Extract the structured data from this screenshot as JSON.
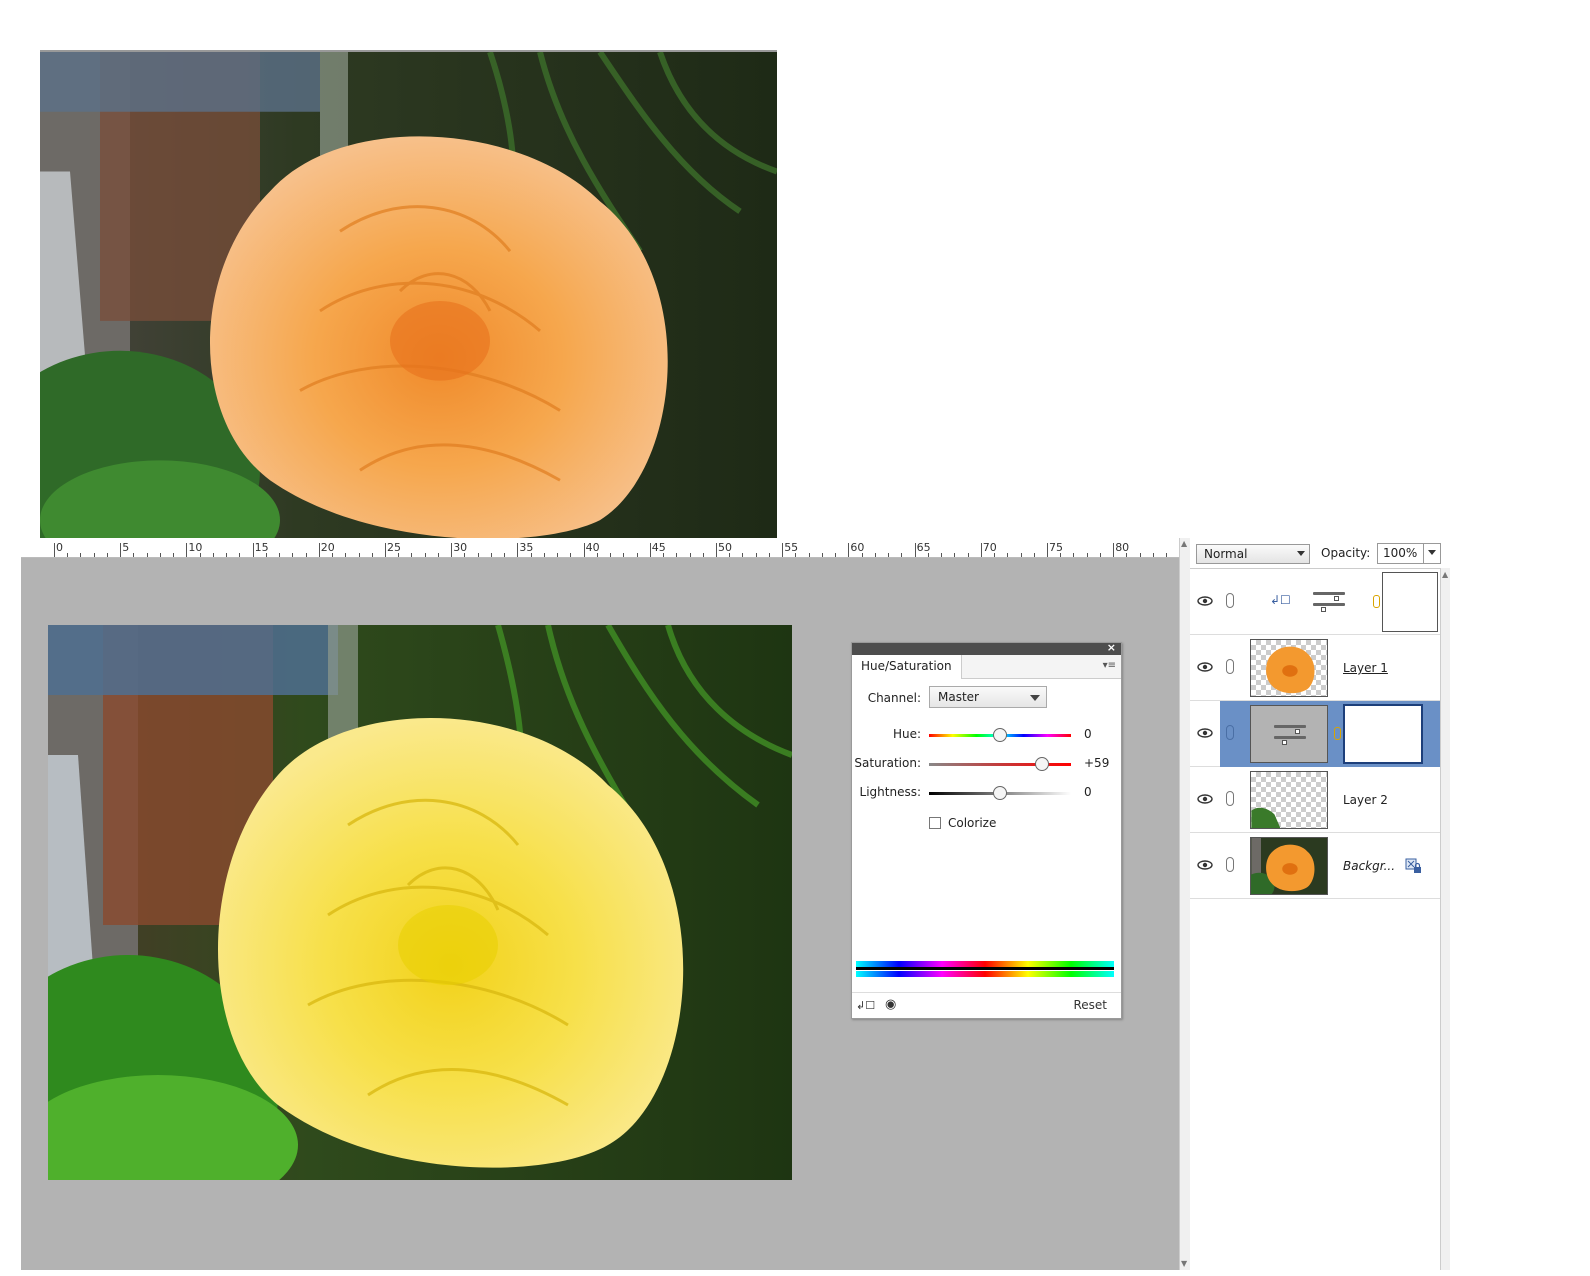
{
  "ruler": {
    "labels": [
      "0",
      "5",
      "10",
      "15",
      "20",
      "25",
      "30",
      "35",
      "40",
      "45",
      "50",
      "55",
      "60",
      "65",
      "70",
      "75",
      "80"
    ]
  },
  "hue_saturation": {
    "tab_title": "Hue/Saturation",
    "channel_label": "Channel:",
    "channel_value": "Master",
    "hue_label": "Hue:",
    "hue_value": "0",
    "hue_position": 0.5,
    "saturation_label": "Saturation:",
    "saturation_value": "+59",
    "saturation_position": 0.795,
    "lightness_label": "Lightness:",
    "lightness_value": "0",
    "lightness_position": 0.5,
    "colorize_label": "Colorize",
    "colorize_checked": false,
    "reset_label": "Reset"
  },
  "layers": {
    "blend_mode": "Normal",
    "opacity_label": "Opacity:",
    "opacity_value": "100%",
    "items": [
      {
        "name": "",
        "type": "adjustment-clipped",
        "selected": false
      },
      {
        "name": "Layer 1",
        "type": "pixel",
        "selected": false
      },
      {
        "name": "",
        "type": "adjustment",
        "selected": true
      },
      {
        "name": "Layer 2",
        "type": "pixel",
        "selected": false
      },
      {
        "name": "Backgr...",
        "type": "background",
        "selected": false
      }
    ]
  },
  "colors": {
    "canvas_bg": "#b3b3b3",
    "selected_layer": "#6a90c6",
    "panel_titlebar": "#4d4d4d"
  }
}
